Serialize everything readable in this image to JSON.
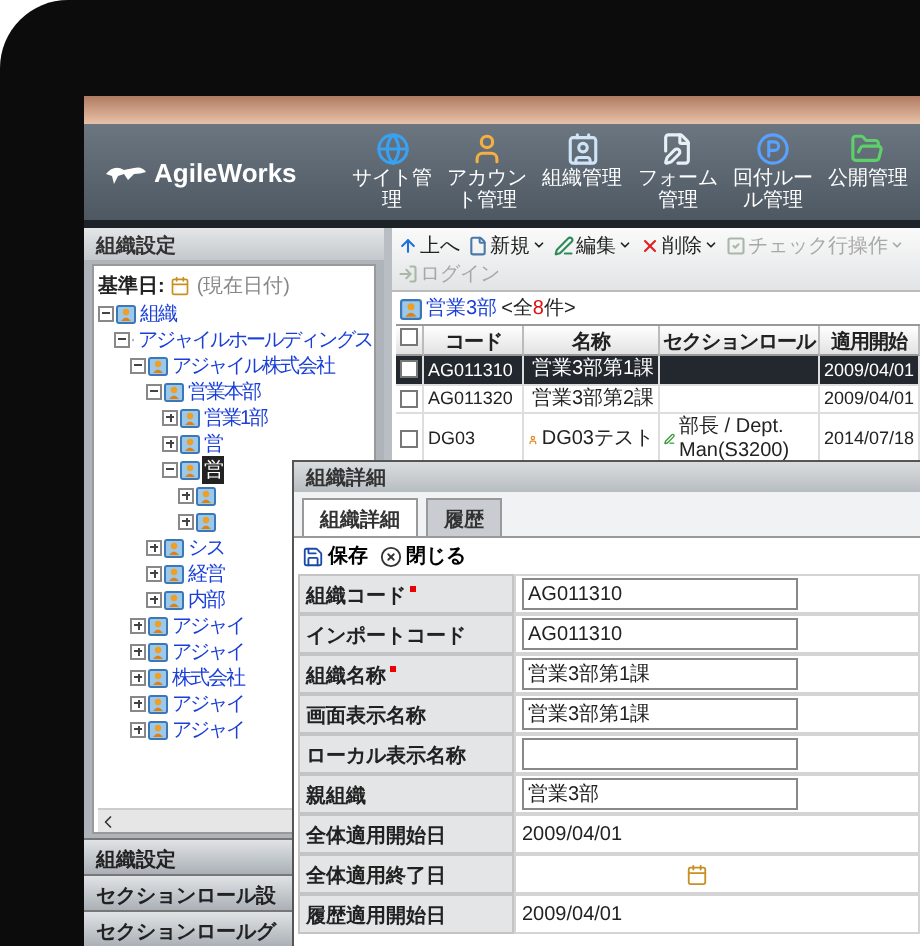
{
  "logo": {
    "text": "AgileWorks"
  },
  "nav": [
    {
      "label": "サイト管理"
    },
    {
      "label": "アカウント管理"
    },
    {
      "label": "組織管理"
    },
    {
      "label": "フォーム管理"
    },
    {
      "label": "回付ルール管理"
    },
    {
      "label": "公開管理"
    }
  ],
  "left_panel": {
    "title": "組織設定",
    "base_date": {
      "label": "基準日:",
      "value": "(現在日付)"
    },
    "tree": [
      {
        "label": "組織",
        "expanded": true,
        "selected": false,
        "children": [
          {
            "label": "アジャイルホールディングス",
            "expanded": true,
            "selected": false,
            "children": [
              {
                "label": "アジャイル株式会社",
                "expanded": true,
                "selected": false,
                "children": [
                  {
                    "label": "営業本部",
                    "expanded": true,
                    "selected": false,
                    "children": [
                      {
                        "label": "営業1部",
                        "expanded": false,
                        "selected": false
                      },
                      {
                        "label": "営",
                        "expanded": false,
                        "selected": false
                      },
                      {
                        "label": "営",
                        "expanded": true,
                        "selected": true,
                        "children": [
                          {
                            "expanded": false
                          },
                          {
                            "expanded": false
                          }
                        ]
                      }
                    ]
                  },
                  {
                    "label": "シス",
                    "expanded": false,
                    "selected": false
                  },
                  {
                    "label": "経営",
                    "expanded": false,
                    "selected": false
                  },
                  {
                    "label": "内部",
                    "expanded": false,
                    "selected": false
                  }
                ]
              },
              {
                "label": "アジャイ",
                "expanded": false,
                "selected": false
              },
              {
                "label": "アジャイ",
                "expanded": false,
                "selected": false
              },
              {
                "label": "株式会社",
                "expanded": false,
                "selected": false
              },
              {
                "label": "アジャイ",
                "expanded": false,
                "selected": false
              },
              {
                "label": "アジャイ",
                "expanded": false,
                "selected": false
              }
            ]
          }
        ]
      }
    ]
  },
  "accordion": [
    {
      "label": "組織設定"
    },
    {
      "label": "セクションロール設"
    },
    {
      "label": "セクションロールグ"
    }
  ],
  "toolbar": [
    {
      "label": "上へ",
      "dropdown": false,
      "disabled": false
    },
    {
      "label": "新規",
      "dropdown": true,
      "disabled": false
    },
    {
      "label": "編集",
      "dropdown": true,
      "disabled": false
    },
    {
      "label": "削除",
      "dropdown": true,
      "disabled": false
    },
    {
      "label": "チェック行操作",
      "dropdown": true,
      "disabled": true
    },
    {
      "label": "ログイン",
      "dropdown": false,
      "disabled": true
    }
  ],
  "breadcrumb": {
    "folder": "営業3部",
    "count_prefix": "<全",
    "count": "8",
    "count_suffix": "件>"
  },
  "table": {
    "all_checked": false,
    "columns": [
      "コード",
      "名称",
      "セクションロール",
      "適用開始"
    ],
    "rows": [
      {
        "checked": false,
        "selected": true,
        "code": "AG011310",
        "kind": "org",
        "name": "営業3部第1課",
        "start": "2009/04/01"
      },
      {
        "checked": false,
        "selected": false,
        "code": "AG011320",
        "kind": "org",
        "name": "営業3部第2課",
        "start": "2009/04/01"
      },
      {
        "checked": false,
        "selected": false,
        "code": "DG03",
        "kind": "user",
        "name": "DG03テスト",
        "role": "部長 / Dept. Man(S3200)",
        "start": "2014/07/18"
      }
    ]
  },
  "dialog": {
    "title": "組織詳細",
    "tabs": [
      {
        "label": "組織詳細",
        "selected": true
      },
      {
        "label": "履歴",
        "selected": false
      }
    ],
    "actions": [
      "保存",
      "閉じる"
    ],
    "fields": [
      {
        "label": "組織コード",
        "required": true,
        "kind": "input",
        "value": "AG011310"
      },
      {
        "label": "インポートコード",
        "required": false,
        "kind": "input",
        "value": "AG011310"
      },
      {
        "label": "組織名称",
        "required": true,
        "kind": "input",
        "value": "営業3部第1課"
      },
      {
        "label": "画面表示名称",
        "required": false,
        "kind": "input",
        "value": "営業3部第1課"
      },
      {
        "label": "ローカル表示名称",
        "required": false,
        "kind": "input"
      },
      {
        "label": "親組織",
        "required": false,
        "kind": "input",
        "value": "営業3部"
      },
      {
        "label": "全体適用開始日",
        "required": false,
        "kind": "text",
        "value": "2009/04/01"
      },
      {
        "label": "全体適用終了日",
        "required": false,
        "kind": "date"
      },
      {
        "label": "履歴適用開始日",
        "required": false,
        "kind": "text",
        "value": "2009/04/01"
      }
    ]
  }
}
